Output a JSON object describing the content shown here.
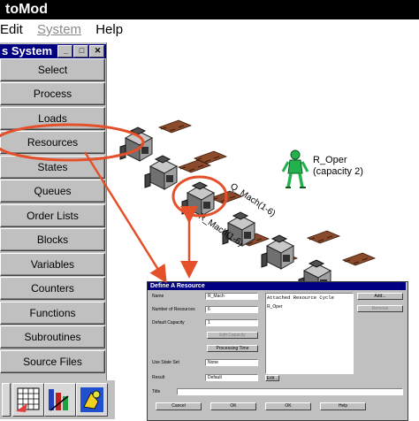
{
  "app": {
    "title": "toMod"
  },
  "menu": {
    "edit": "Edit",
    "system": "System",
    "help": "Help"
  },
  "panel": {
    "title": "s System",
    "buttons": [
      "Select",
      "Process",
      "Loads",
      "Resources",
      "States",
      "Queues",
      "Order Lists",
      "Blocks",
      "Variables",
      "Counters",
      "Functions",
      "Subroutines",
      "Source Files"
    ]
  },
  "scene": {
    "oper_label": "R_Oper",
    "oper_capacity": "(capacity 2)",
    "mach_label_1": "Q_Mach(1-6)",
    "mach_label_2": "R_Mach(1-6)"
  },
  "dialog": {
    "title": "Define A Resource",
    "labels": {
      "name": "Name",
      "num_resources": "Number of Resources",
      "default_capacity": "Default Capacity",
      "use_state_set": "Use State Set",
      "result": "Result",
      "title": "Title"
    },
    "values": {
      "name": "R_Mach",
      "num_resources": "6",
      "default_capacity": "1",
      "use_state_set": "None",
      "result": "Default"
    },
    "list_header": "Attached Resource Cycle",
    "list_items": [
      "R_Oper"
    ],
    "buttons": {
      "edit_capacity": "Edit Capacity",
      "processing_time": "Processing Time",
      "add": "Add...",
      "remove": "Remove",
      "edit": "Edit...",
      "cancel": "Cancel",
      "ok": "OK",
      "ok2": "OK",
      "help": "Help"
    }
  },
  "colors": {
    "highlight_ring": "#e4502a",
    "titlebar": "#000080",
    "operator": "#22b14c"
  }
}
